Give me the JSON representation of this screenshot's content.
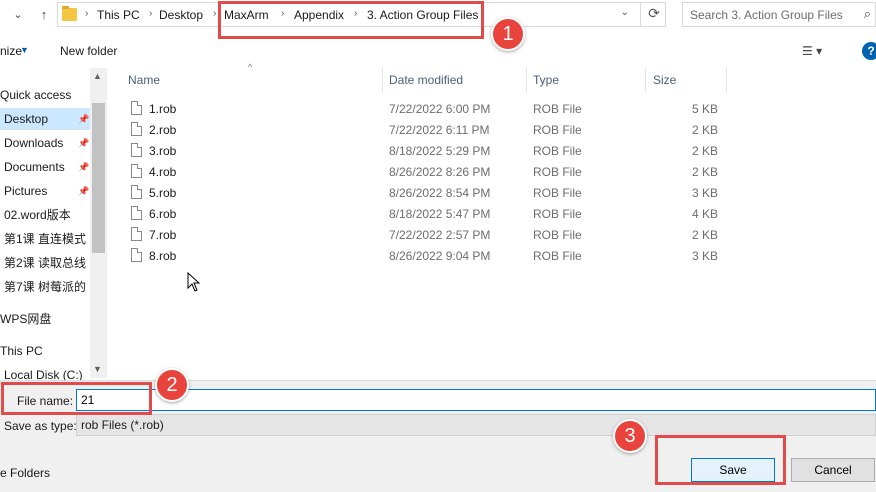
{
  "address_bar": {
    "breadcrumbs": [
      "This PC",
      "Desktop",
      "MaxArm",
      "Appendix",
      "3. Action Group Files"
    ]
  },
  "search": {
    "placeholder": "Search 3. Action Group Files"
  },
  "toolbar": {
    "organize_label": "nize",
    "new_folder_label": "New folder"
  },
  "nav_pane": {
    "quick_access": "Quick access",
    "items": [
      {
        "label": "Desktop",
        "pinned": true,
        "selected": true
      },
      {
        "label": "Downloads",
        "pinned": true
      },
      {
        "label": "Documents",
        "pinned": true
      },
      {
        "label": "Pictures",
        "pinned": true
      },
      {
        "label": "02.word版本"
      },
      {
        "label": "第1课 直连模式"
      },
      {
        "label": "第2课 读取总线"
      },
      {
        "label": "第7课 树莓派的"
      }
    ],
    "wps": "WPS网盘",
    "this_pc": "This PC",
    "local_disk": "Local Disk (C:)"
  },
  "columns": {
    "name": "Name",
    "date": "Date modified",
    "type": "Type",
    "size": "Size"
  },
  "files": [
    {
      "name": "1.rob",
      "date": "7/22/2022 6:00 PM",
      "type": "ROB File",
      "size": "5 KB"
    },
    {
      "name": "2.rob",
      "date": "7/22/2022 6:11 PM",
      "type": "ROB File",
      "size": "2 KB"
    },
    {
      "name": "3.rob",
      "date": "8/18/2022 5:29 PM",
      "type": "ROB File",
      "size": "2 KB"
    },
    {
      "name": "4.rob",
      "date": "8/26/2022 8:26 PM",
      "type": "ROB File",
      "size": "2 KB"
    },
    {
      "name": "5.rob",
      "date": "8/26/2022 8:54 PM",
      "type": "ROB File",
      "size": "3 KB"
    },
    {
      "name": "6.rob",
      "date": "8/18/2022 5:47 PM",
      "type": "ROB File",
      "size": "4 KB"
    },
    {
      "name": "7.rob",
      "date": "7/22/2022 2:57 PM",
      "type": "ROB File",
      "size": "2 KB"
    },
    {
      "name": "8.rob",
      "date": "8/26/2022 9:04 PM",
      "type": "ROB File",
      "size": "3 KB"
    }
  ],
  "save_panel": {
    "file_name_label": "File name:",
    "file_name_value": "21",
    "save_type_label": "Save as type:",
    "save_type_value": "rob Files (*.rob)",
    "hide_folders_label": "e Folders",
    "save_label": "Save",
    "cancel_label": "Cancel"
  },
  "annotations": {
    "badge_1": "1",
    "badge_2": "2",
    "badge_3": "3",
    "color": "#e34a4a"
  }
}
